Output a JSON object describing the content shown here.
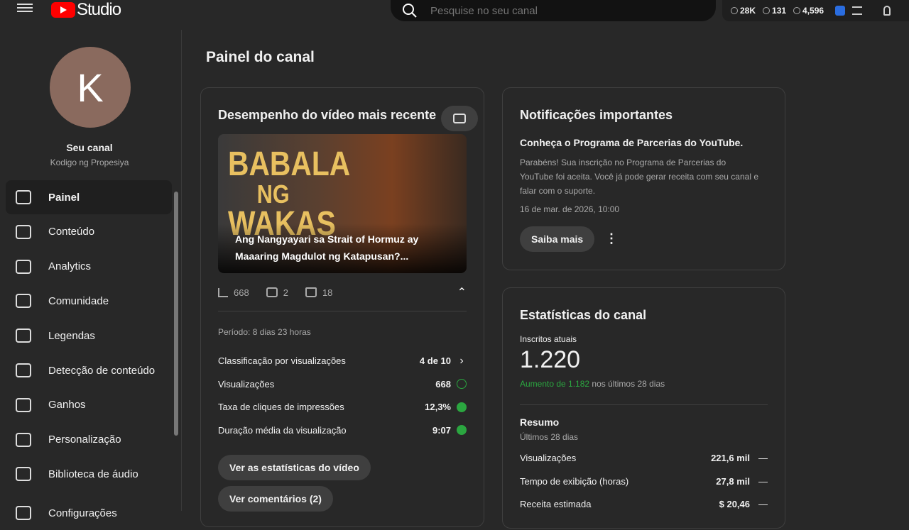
{
  "header": {
    "logo_text": "Studio",
    "search_placeholder": "Pesquise no seu canal",
    "stats": [
      "28K",
      "131",
      "4,596"
    ]
  },
  "sidebar": {
    "avatar_letter": "K",
    "channel_label": "Seu canal",
    "channel_name": "Kodigo ng Propesiya",
    "items": [
      {
        "label": "Painel",
        "icon": "dashboard-icon"
      },
      {
        "label": "Conteúdo",
        "icon": "content-icon"
      },
      {
        "label": "Analytics",
        "icon": "analytics-icon"
      },
      {
        "label": "Comunidade",
        "icon": "community-icon"
      },
      {
        "label": "Legendas",
        "icon": "subtitles-icon"
      },
      {
        "label": "Detecção de conteúdo",
        "icon": "copyright-icon"
      },
      {
        "label": "Ganhos",
        "icon": "dollar-icon"
      },
      {
        "label": "Personalização",
        "icon": "magic-wand-icon"
      },
      {
        "label": "Biblioteca de áudio",
        "icon": "audio-library-icon"
      },
      {
        "label": "Configurações",
        "icon": "gear-icon"
      }
    ]
  },
  "page_title": "Painel do canal",
  "latest": {
    "title": "Desempenho do vídeo mais recente",
    "thumb_text": [
      "BABALA",
      "NG",
      "WAKAS"
    ],
    "video_title": "Ang Nangyayari sa Strait of Hormuz ay Maaaring Magdulot ng Katapusan?...",
    "views": "668",
    "comments": "2",
    "likes": "18",
    "period": "Período: 8 dias 23 horas",
    "metrics": [
      {
        "label": "Classificação por visualizações",
        "value": "4 de 10"
      },
      {
        "label": "Visualizações",
        "value": "668"
      },
      {
        "label": "Taxa de cliques de impressões",
        "value": "12,3%"
      },
      {
        "label": "Duração média da visualização",
        "value": "9:07"
      }
    ],
    "btn_stats": "Ver as estatísticas do vídeo",
    "btn_comments": "Ver comentários (2)"
  },
  "notif": {
    "title": "Notificações importantes",
    "heading": "Conheça o Programa de Parcerias do YouTube.",
    "body": "Parabéns! Sua inscrição no Programa de Parcerias do YouTube foi aceita. Você já pode gerar receita com seu canal e falar com o suporte.",
    "date": "16 de mar. de 2026, 10:00",
    "button": "Saiba mais"
  },
  "channel_stats": {
    "title": "Estatísticas do canal",
    "subs_label": "Inscritos atuais",
    "subs": "1.220",
    "growth": "Aumento de 1.182",
    "growth_suffix": " nos últimos 28 dias",
    "summary": "Resumo",
    "summary_sub": "Últimos 28 dias",
    "rows": [
      {
        "label": "Visualizações",
        "value": "221,6 mil"
      },
      {
        "label": "Tempo de exibição (horas)",
        "value": "27,8 mil"
      },
      {
        "label": "Receita estimada",
        "value": "$ 20,46"
      }
    ]
  },
  "colors": {
    "green": "#2ba640",
    "red": "#ff0000"
  }
}
